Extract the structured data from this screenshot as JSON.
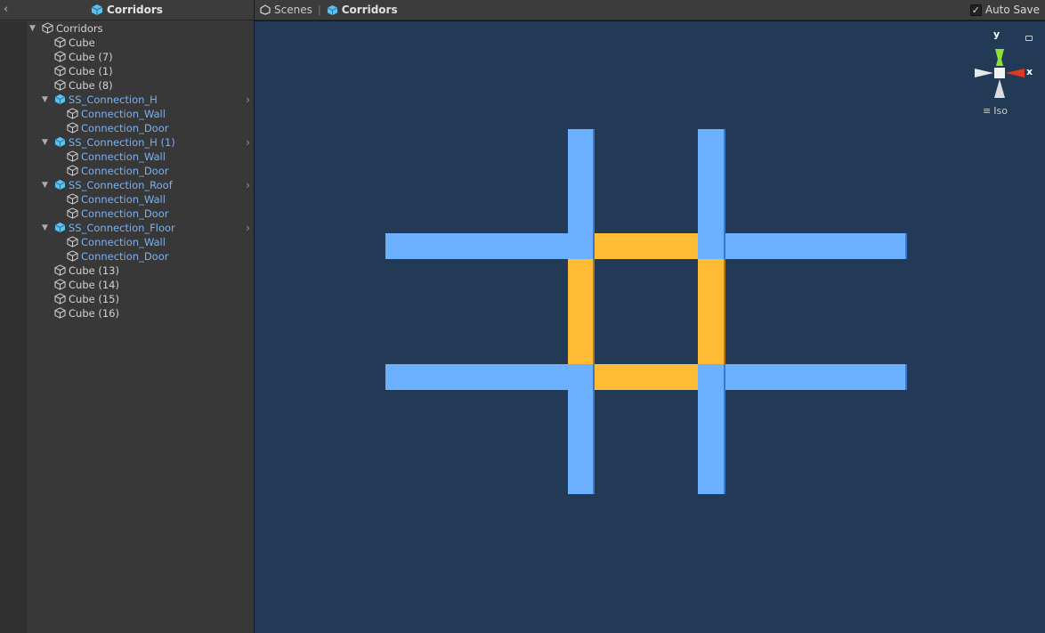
{
  "hierarchy": {
    "title": "Corridors",
    "back_icon": "chevron-left-icon",
    "items": [
      {
        "label": "Corridors",
        "level": 0,
        "type": "gameobject",
        "expanded": true
      },
      {
        "label": "Cube",
        "level": 1,
        "type": "gameobject"
      },
      {
        "label": "Cube (7)",
        "level": 1,
        "type": "gameobject"
      },
      {
        "label": "Cube (1)",
        "level": 1,
        "type": "gameobject"
      },
      {
        "label": "Cube (8)",
        "level": 1,
        "type": "gameobject"
      },
      {
        "label": "SS_Connection_H",
        "level": 1,
        "type": "prefab",
        "expanded": true
      },
      {
        "label": "Connection_Wall",
        "level": 2,
        "type": "child"
      },
      {
        "label": "Connection_Door",
        "level": 2,
        "type": "child"
      },
      {
        "label": "SS_Connection_H (1)",
        "level": 1,
        "type": "prefab",
        "expanded": true
      },
      {
        "label": "Connection_Wall",
        "level": 2,
        "type": "child"
      },
      {
        "label": "Connection_Door",
        "level": 2,
        "type": "child"
      },
      {
        "label": "SS_Connection_Roof",
        "level": 1,
        "type": "prefab",
        "expanded": true
      },
      {
        "label": "Connection_Wall",
        "level": 2,
        "type": "child"
      },
      {
        "label": "Connection_Door",
        "level": 2,
        "type": "child"
      },
      {
        "label": "SS_Connection_Floor",
        "level": 1,
        "type": "prefab",
        "expanded": true
      },
      {
        "label": "Connection_Wall",
        "level": 2,
        "type": "child"
      },
      {
        "label": "Connection_Door",
        "level": 2,
        "type": "child"
      },
      {
        "label": "Cube (13)",
        "level": 1,
        "type": "gameobject"
      },
      {
        "label": "Cube (14)",
        "level": 1,
        "type": "gameobject"
      },
      {
        "label": "Cube (15)",
        "level": 1,
        "type": "gameobject"
      },
      {
        "label": "Cube (16)",
        "level": 1,
        "type": "gameobject"
      }
    ]
  },
  "scene": {
    "breadcrumb": [
      "Scenes",
      "Corridors"
    ],
    "auto_save_label": "Auto Save",
    "auto_save_checked": true,
    "gizmo": {
      "y_label": "y",
      "x_label": "x",
      "projection_label": "Iso"
    },
    "colors": {
      "background": "#233a56",
      "corridor": "#6bb1ff",
      "connection": "#ffbb33"
    }
  }
}
